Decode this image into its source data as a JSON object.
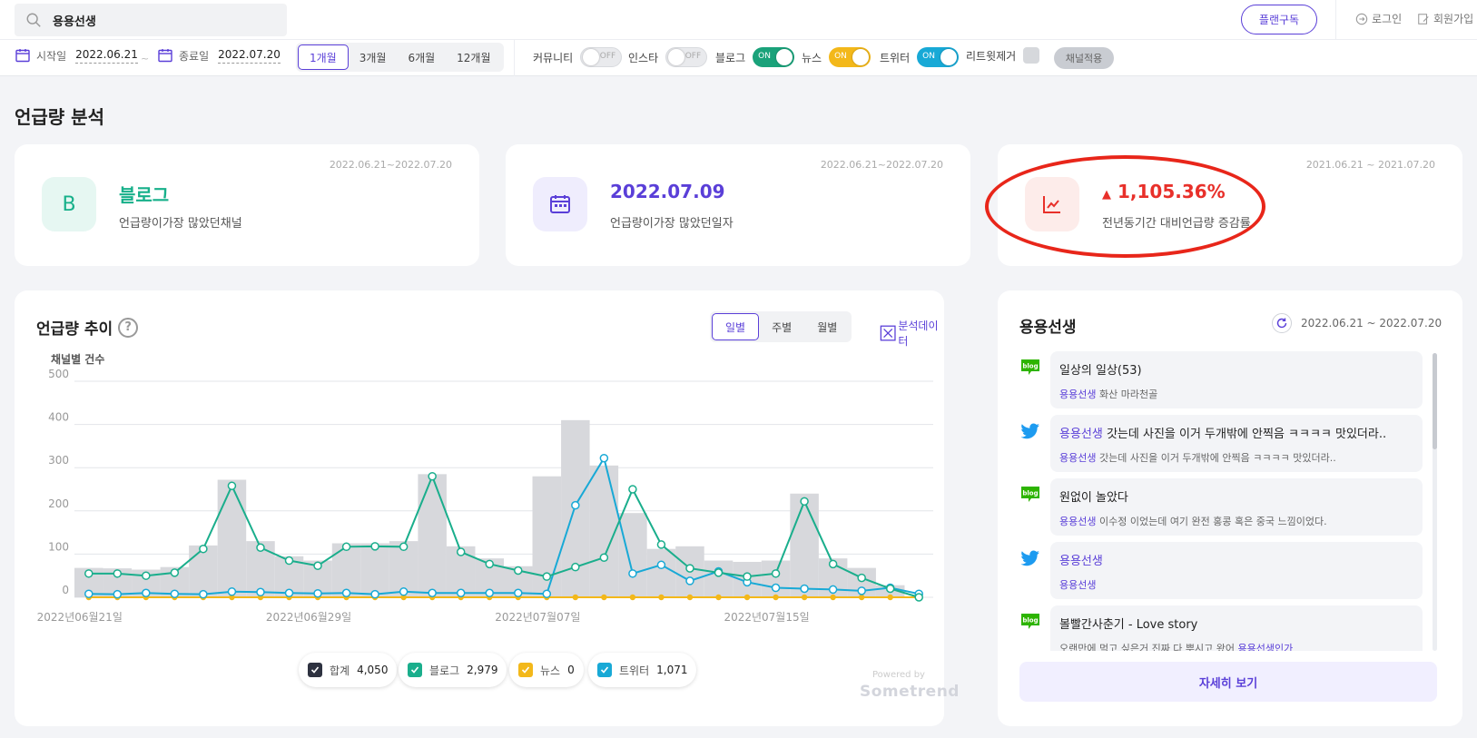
{
  "search": {
    "query": "용용선생"
  },
  "header": {
    "plan_label": "플랜구독",
    "login_label": "로그인",
    "signup_label": "회원가입"
  },
  "filters": {
    "start_label": "시작일",
    "start_date": "2022.06.21",
    "end_label": "종료일",
    "end_date": "2022.07.20",
    "range_sep": "~",
    "periods": [
      "1개월",
      "3개월",
      "6개월",
      "12개월"
    ],
    "channels": [
      {
        "label": "커뮤니티",
        "state": "OFF"
      },
      {
        "label": "인스타",
        "state": "OFF"
      },
      {
        "label": "블로그",
        "state": "ON",
        "color": "#1aa27a"
      },
      {
        "label": "뉴스",
        "state": "ON",
        "color": "#f3b81a"
      },
      {
        "label": "트위터",
        "state": "ON",
        "color": "#18a9d6"
      }
    ],
    "retweet_label": "리트윗제거",
    "apply_label": "채널적용"
  },
  "section_title": "언급량 분석",
  "kpis": [
    {
      "date": "2022.06.21~2022.07.20",
      "icon_letter": "B",
      "value": "블로그",
      "sub": "언급량이가장 많았던채널",
      "color": "#17b08a"
    },
    {
      "date": "2022.06.21~2022.07.20",
      "value": "2022.07.09",
      "sub": "언급량이가장 많았던일자",
      "color": "#5a3fd8"
    },
    {
      "date": "2021.06.21 ~ 2021.07.20",
      "value": "1,105.36%",
      "sub": "전년동기간 대비언급량 증감률",
      "color": "#e8302a"
    }
  ],
  "trend": {
    "title": "언급량 추이",
    "help": "?",
    "tabs": [
      "일별",
      "주별",
      "월별"
    ],
    "export_label": "분석데이터",
    "ylabel": "채널별 건수",
    "powered": "Powered by",
    "brand": "Sometrend"
  },
  "chart_data": {
    "type": "line",
    "ylabel": "채널별 건수",
    "ylim": [
      0,
      500
    ],
    "yticks": [
      0,
      100,
      200,
      300,
      400,
      500
    ],
    "xtick_labels": [
      "2022년06월21일",
      "2022년06월29일",
      "2022년07월07일",
      "2022년07월15일"
    ],
    "xtick_index": [
      0,
      8,
      16,
      24
    ],
    "x": [
      "06.21",
      "06.22",
      "06.23",
      "06.24",
      "06.25",
      "06.26",
      "06.27",
      "06.28",
      "06.29",
      "06.30",
      "07.01",
      "07.02",
      "07.03",
      "07.04",
      "07.05",
      "07.06",
      "07.07",
      "07.08",
      "07.09",
      "07.10",
      "07.11",
      "07.12",
      "07.13",
      "07.14",
      "07.15",
      "07.16",
      "07.17",
      "07.18",
      "07.19",
      "07.20"
    ],
    "series": [
      {
        "name": "합계",
        "total": "4,050",
        "color": "#2e3240",
        "values": [
          68,
          67,
          64,
          70,
          120,
          272,
          130,
          95,
          85,
          125,
          125,
          130,
          285,
          118,
          90,
          72,
          280,
          410,
          305,
          195,
          112,
          118,
          85,
          82,
          85,
          240,
          90,
          68,
          28,
          0
        ]
      },
      {
        "name": "블로그",
        "total": "2,979",
        "color": "#1aae8c",
        "values": [
          55,
          55,
          50,
          57,
          112,
          258,
          115,
          85,
          73,
          117,
          118,
          117,
          280,
          105,
          77,
          62,
          48,
          70,
          92,
          250,
          122,
          67,
          57,
          48,
          55,
          222,
          77,
          45,
          20,
          0
        ]
      },
      {
        "name": "뉴스",
        "total": "0",
        "color": "#f3b81a",
        "values": [
          0,
          0,
          0,
          0,
          0,
          0,
          0,
          0,
          0,
          0,
          0,
          0,
          0,
          0,
          0,
          0,
          0,
          0,
          0,
          0,
          0,
          0,
          0,
          0,
          0,
          0,
          0,
          0,
          0,
          0
        ]
      },
      {
        "name": "트위터",
        "total": "1,071",
        "color": "#18a9d6",
        "values": [
          8,
          7,
          10,
          8,
          7,
          13,
          12,
          10,
          9,
          10,
          7,
          13,
          10,
          10,
          10,
          10,
          8,
          213,
          322,
          55,
          75,
          38,
          60,
          35,
          22,
          20,
          18,
          15,
          22,
          8
        ]
      }
    ]
  },
  "side": {
    "title": "용용선생",
    "date": "2022.06.21 ~ 2022.07.20",
    "items": [
      {
        "type": "blog",
        "title": "일상의 일상(53)",
        "snippet_hl": "용용선생",
        "snippet": " 화산 마라천골"
      },
      {
        "type": "twitter",
        "title_hl": "용용선생",
        "title": " 갓는데 사진을 이거 두개밖에 안찍음 ㅋㅋㅋㅋ 맛있더라..",
        "snippet_hl": "용용선생",
        "snippet": " 갓는데 사진을 이거 두개밖에 안찍음 ㅋㅋㅋㅋ 맛있더라.."
      },
      {
        "type": "blog",
        "title": "원없이 놀았다",
        "snippet_hl": "용용선생",
        "snippet": " 이수정 이었는데 여기 완전 홍콩 혹은 중국 느낌이었다."
      },
      {
        "type": "twitter",
        "title_hl": "용용선생",
        "title": "",
        "snippet_hl": "용용선생",
        "snippet": ""
      },
      {
        "type": "blog",
        "title": "볼빨간사춘기 - Love story",
        "snippet_pre": "오랜만에 먹고 싶은거 진짜 다 뿌시고 왔어 ",
        "snippet_hl": "용용선생인가"
      }
    ],
    "more_label": "자세히 보기"
  }
}
